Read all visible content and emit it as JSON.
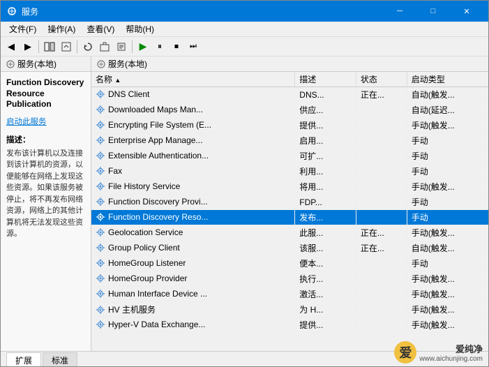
{
  "window": {
    "title": "服务",
    "title_icon": "⚙"
  },
  "title_controls": {
    "minimize": "─",
    "maximize": "□",
    "close": "✕"
  },
  "menu": {
    "items": [
      {
        "label": "文件(F)"
      },
      {
        "label": "操作(A)"
      },
      {
        "label": "查看(V)"
      },
      {
        "label": "帮助(H)"
      }
    ]
  },
  "toolbar": {
    "buttons": [
      "←",
      "→",
      "⊞",
      "⊟",
      "↺",
      "📋",
      "🖊",
      "▶",
      "⏸",
      "⏹",
      "⏭"
    ]
  },
  "panel_header": {
    "left_label": "服务(本地)",
    "right_label": "服务(本地)"
  },
  "left_panel": {
    "service_name": "Function Discovery Resource Publication",
    "start_link": "启动此服务",
    "desc_label": "描述：",
    "desc_text": "发布该计算机以及连接到该计算机的资源，以便能够在网络上发现这些资源。如果该服务被停止，将不再发布网络资源，网络上的其他计算机将无法发现这些资源。"
  },
  "table": {
    "columns": [
      "名称",
      "描述",
      "状态",
      "启动类型"
    ],
    "sort_col": "名称",
    "rows": [
      {
        "name": "DNS Client",
        "desc": "DNS...",
        "status": "正在...",
        "start": "自动(触发...",
        "selected": false
      },
      {
        "name": "Downloaded Maps Man...",
        "desc": "供应...",
        "status": "",
        "start": "自动(延迟...",
        "selected": false
      },
      {
        "name": "Encrypting File System (E...",
        "desc": "提供...",
        "status": "",
        "start": "手动(触发...",
        "selected": false
      },
      {
        "name": "Enterprise App Manage...",
        "desc": "启用...",
        "status": "",
        "start": "手动",
        "selected": false
      },
      {
        "name": "Extensible Authentication...",
        "desc": "可扩...",
        "status": "",
        "start": "手动",
        "selected": false
      },
      {
        "name": "Fax",
        "desc": "利用...",
        "status": "",
        "start": "手动",
        "selected": false
      },
      {
        "name": "File History Service",
        "desc": "将用...",
        "status": "",
        "start": "手动(触发...",
        "selected": false
      },
      {
        "name": "Function Discovery Provi...",
        "desc": "FDP...",
        "status": "",
        "start": "手动",
        "selected": false
      },
      {
        "name": "Function Discovery Reso...",
        "desc": "发布...",
        "status": "",
        "start": "手动",
        "selected": true
      },
      {
        "name": "Geolocation Service",
        "desc": "此服...",
        "status": "正在...",
        "start": "手动(触发...",
        "selected": false
      },
      {
        "name": "Group Policy Client",
        "desc": "该服...",
        "status": "正在...",
        "start": "自动(触发...",
        "selected": false
      },
      {
        "name": "HomeGroup Listener",
        "desc": "便本...",
        "status": "",
        "start": "手动",
        "selected": false
      },
      {
        "name": "HomeGroup Provider",
        "desc": "执行...",
        "status": "",
        "start": "手动(触发...",
        "selected": false
      },
      {
        "name": "Human Interface Device ...",
        "desc": "激活...",
        "status": "",
        "start": "手动(触发...",
        "selected": false
      },
      {
        "name": "HV 主机服务",
        "desc": "为 H...",
        "status": "",
        "start": "手动(触发...",
        "selected": false
      },
      {
        "name": "Hyper-V Data Exchange...",
        "desc": "提供...",
        "status": "",
        "start": "手动(触发...",
        "selected": false
      }
    ]
  },
  "bottom_tabs": [
    {
      "label": "扩展",
      "active": true
    },
    {
      "label": "标准",
      "active": false
    }
  ],
  "watermark": {
    "logo_char": "爱",
    "line1": "爱纯净",
    "line2": "www.aichunjing.com"
  }
}
